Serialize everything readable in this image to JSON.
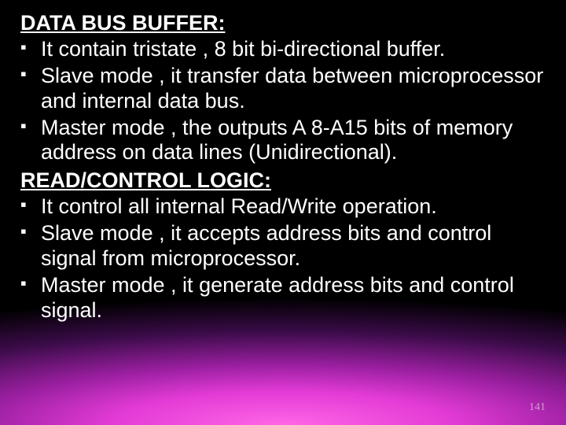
{
  "heading1": "DATA BUS BUFFER:",
  "bullets1": [
    "It contain tristate , 8 bit bi-directional buffer.",
    "Slave mode , it transfer data between microprocessor and internal data bus.",
    "Master mode , the outputs A 8-A15 bits of memory address  on data lines (Unidirectional)."
  ],
  "heading2": "READ/CONTROL LOGIC:",
  "bullets2": [
    "It control all internal Read/Write operation.",
    "Slave mode , it accepts address bits and control signal from microprocessor.",
    "Master mode , it generate address bits and control signal."
  ],
  "page_number": "141"
}
